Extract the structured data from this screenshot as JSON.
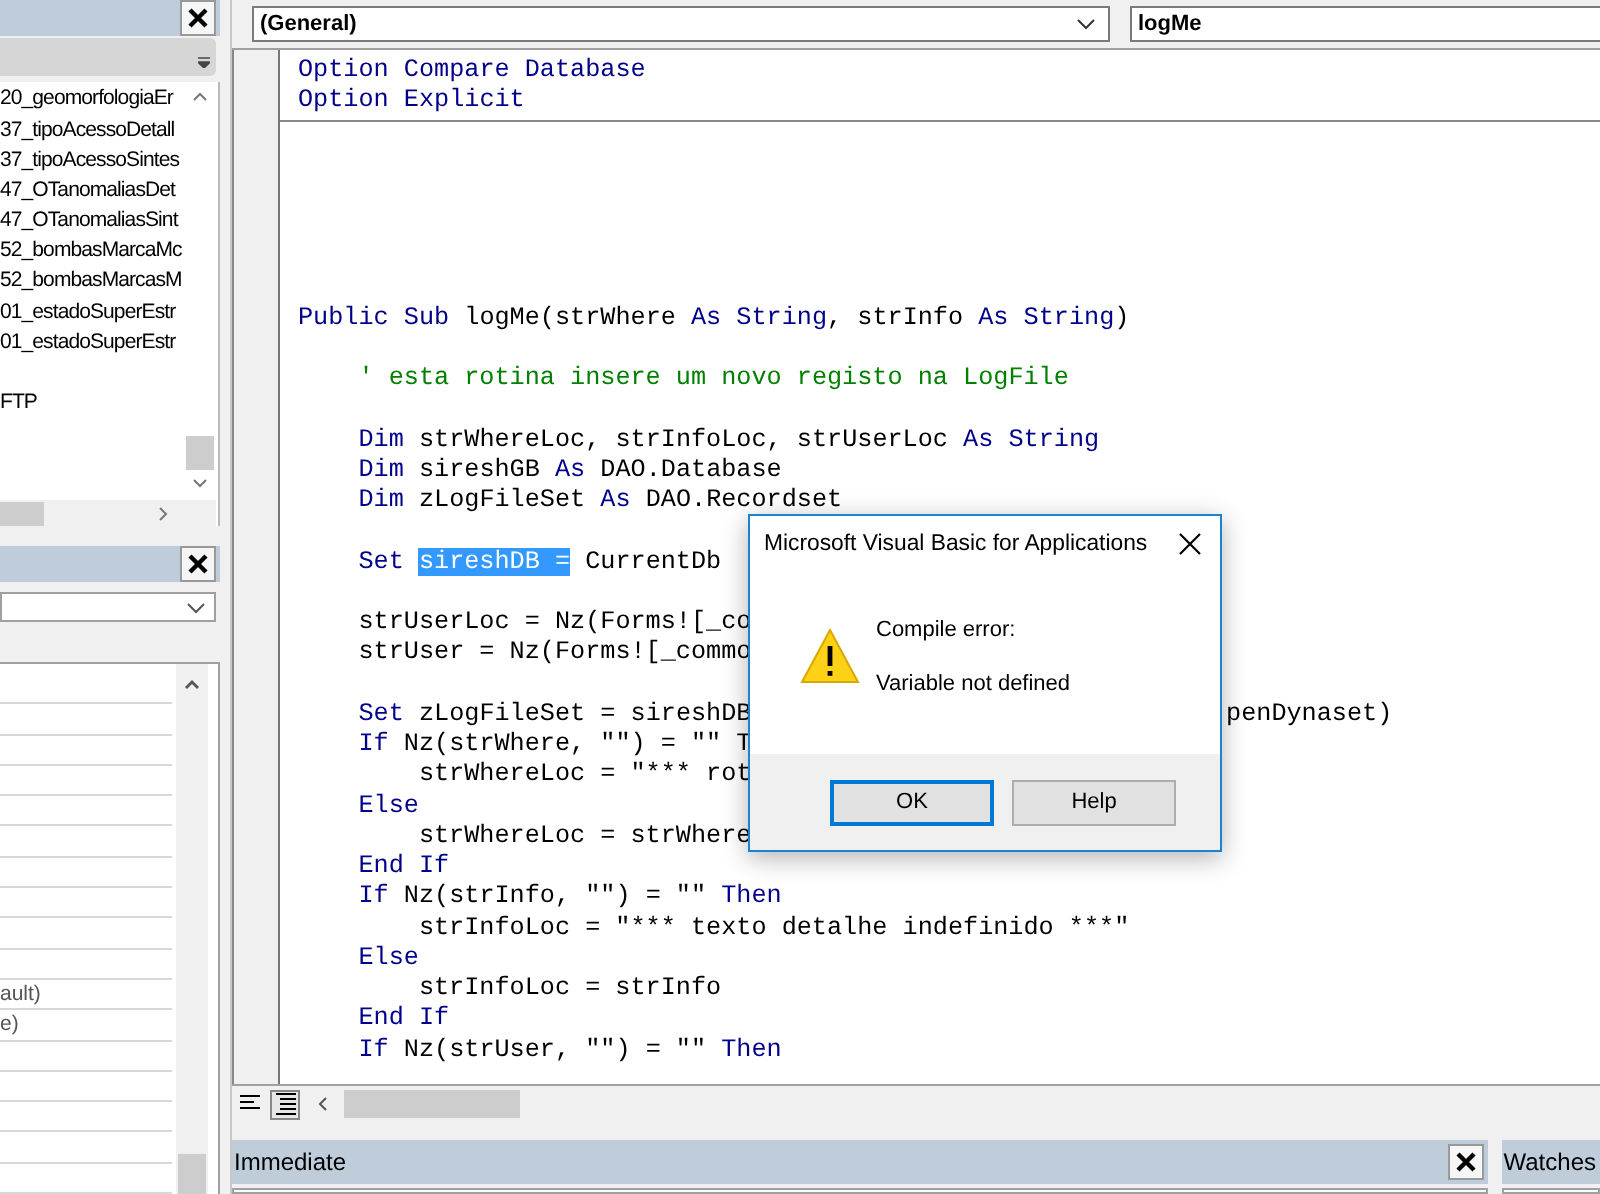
{
  "project_pane": {
    "items": [
      "20_geomorfologiaEr",
      "37_tipoAcessoDetall",
      "37_tipoAcessoSintes",
      "47_OTanomaliasDet",
      "47_OTanomaliasSint",
      "52_bombasMarcaMc",
      "52_bombasMarcasM",
      "01_estadoSuperEstr",
      "01_estadoSuperEstr",
      {
        "text": "FTP",
        "blank_before": true
      }
    ]
  },
  "properties_pane": {
    "cells": [
      "ault)",
      "e)"
    ]
  },
  "code_window": {
    "object_combo": "(General)",
    "procedure_combo": "logMe",
    "sections": [
      {
        "lines": [
          {
            "segments": [
              {
                "kind": "keyword",
                "text": "Option Compare Database"
              }
            ]
          },
          {
            "segments": [
              {
                "kind": "keyword",
                "text": "Option Explicit"
              }
            ]
          }
        ]
      },
      {
        "lines": [
          {
            "segments": [
              {
                "kind": "keyword",
                "text": "Public Sub"
              },
              {
                "kind": "plain",
                "text": " logMe(strWhere "
              },
              {
                "kind": "keyword",
                "text": "As String"
              },
              {
                "kind": "plain",
                "text": ", strInfo "
              },
              {
                "kind": "keyword",
                "text": "As String"
              },
              {
                "kind": "plain",
                "text": ")"
              }
            ],
            "children": [
              {
                "blank_before": true,
                "segments": [
                  {
                    "kind": "comment",
                    "text": "' esta rotina insere um novo registo na LogFile"
                  }
                ]
              },
              {
                "blank_before": true,
                "segments": [
                  {
                    "kind": "keyword",
                    "text": "Dim"
                  },
                  {
                    "kind": "plain",
                    "text": " strWhereLoc, strInfoLoc, strUserLoc "
                  },
                  {
                    "kind": "keyword",
                    "text": "As String"
                  }
                ]
              },
              {
                "segments": [
                  {
                    "kind": "keyword",
                    "text": "Dim"
                  },
                  {
                    "kind": "plain",
                    "text": " sireshGB "
                  },
                  {
                    "kind": "keyword",
                    "text": "As"
                  },
                  {
                    "kind": "plain",
                    "text": " DAO.Database"
                  }
                ]
              },
              {
                "segments": [
                  {
                    "kind": "keyword",
                    "text": "Dim"
                  },
                  {
                    "kind": "plain",
                    "text": " zLogFileSet "
                  },
                  {
                    "kind": "keyword",
                    "text": "As"
                  },
                  {
                    "kind": "plain",
                    "text": " DAO.Recordset"
                  }
                ]
              },
              {
                "blank_before": true,
                "segments": [
                  {
                    "kind": "keyword",
                    "text": "Set "
                  },
                  {
                    "kind": "plain",
                    "text": "sireshDB =",
                    "selected": true
                  },
                  {
                    "kind": "plain",
                    "text": " CurrentDb"
                  }
                ]
              },
              {
                "blank_before": true,
                "segments": [
                  {
                    "kind": "plain",
                    "text": "strUserLoc = Nz(Forms![_co"
                  }
                ]
              },
              {
                "segments": [
                  {
                    "kind": "plain",
                    "text": "strUser = Nz(Forms![_commo"
                  }
                ]
              },
              {
                "blank_before": true,
                "segments": [
                  {
                    "kind": "keyword",
                    "text": "Set"
                  },
                  {
                    "kind": "plain",
                    "text": " zLogFileSet = sireshDB"
                  }
                ],
                "tail": "penDynaset)"
              },
              {
                "segments": [
                  {
                    "kind": "keyword",
                    "text": "If"
                  },
                  {
                    "kind": "plain",
                    "text": " Nz(strWhere, \"\") = \"\" T"
                  }
                ],
                "children": [
                  {
                    "segments": [
                      {
                        "kind": "plain",
                        "text": "strWhereLoc = \"*** rot"
                      }
                    ]
                  }
                ]
              },
              {
                "segments": [
                  {
                    "kind": "keyword",
                    "text": "Else"
                  }
                ],
                "children": [
                  {
                    "segments": [
                      {
                        "kind": "plain",
                        "text": "strWhereLoc = strWhere"
                      }
                    ]
                  }
                ]
              },
              {
                "segments": [
                  {
                    "kind": "keyword",
                    "text": "End If"
                  }
                ]
              },
              {
                "segments": [
                  {
                    "kind": "keyword",
                    "text": "If"
                  },
                  {
                    "kind": "plain",
                    "text": " Nz(strInfo, \"\") = \"\" "
                  },
                  {
                    "kind": "keyword",
                    "text": "Then"
                  }
                ],
                "children": [
                  {
                    "segments": [
                      {
                        "kind": "plain",
                        "text": "strInfoLoc = \"*** texto detalhe indefinido ***\""
                      }
                    ]
                  }
                ]
              },
              {
                "segments": [
                  {
                    "kind": "keyword",
                    "text": "Else"
                  }
                ],
                "children": [
                  {
                    "segments": [
                      {
                        "kind": "plain",
                        "text": "strInfoLoc = strInfo"
                      }
                    ]
                  }
                ]
              },
              {
                "segments": [
                  {
                    "kind": "keyword",
                    "text": "End If"
                  }
                ]
              },
              {
                "segments": [
                  {
                    "kind": "keyword",
                    "text": "If"
                  },
                  {
                    "kind": "plain",
                    "text": " Nz(strUser, \"\") = \"\" "
                  },
                  {
                    "kind": "keyword",
                    "text": "Then"
                  }
                ]
              }
            ]
          }
        ]
      }
    ]
  },
  "immediate_pane": {
    "title": "Immediate"
  },
  "watches_pane": {
    "title": "Watches"
  },
  "dialog": {
    "title": "Microsoft Visual Basic for Applications",
    "heading": "Compile error:",
    "message": "Variable not defined",
    "buttons": [
      {
        "label": "OK",
        "default": true
      },
      {
        "label": "Help",
        "default": false
      }
    ]
  }
}
